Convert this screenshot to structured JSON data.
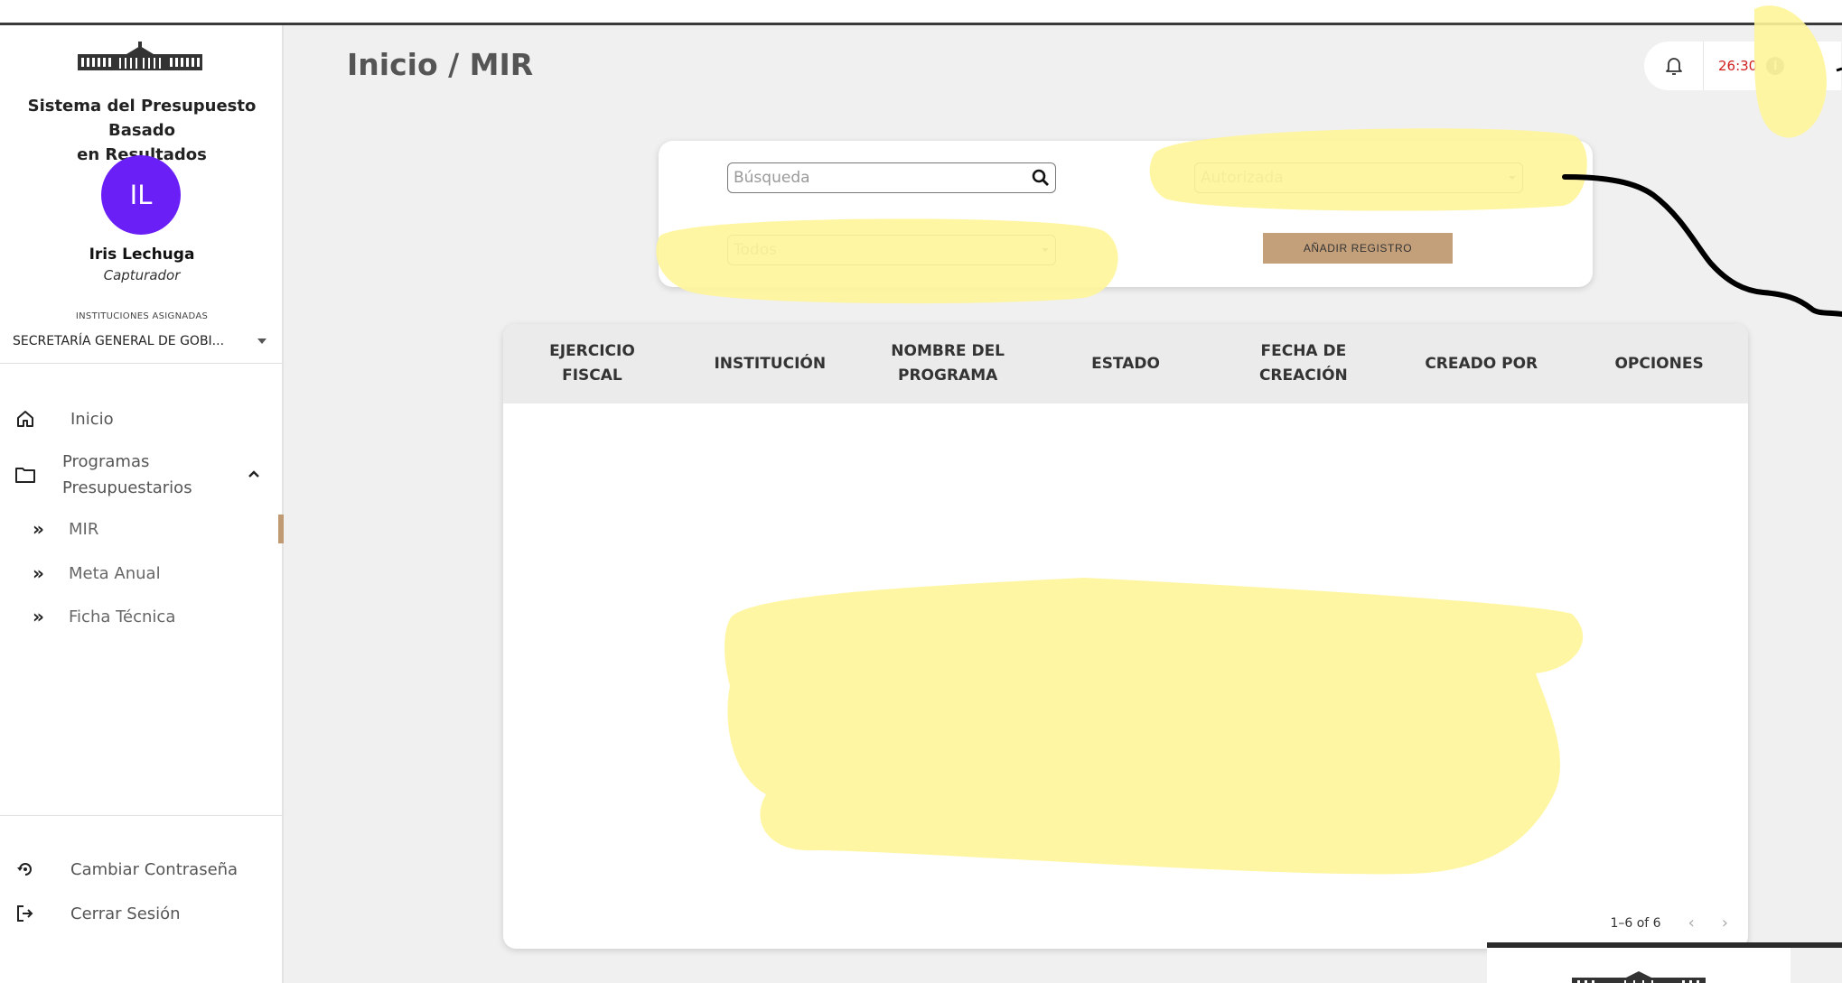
{
  "app": {
    "system_title_line1": "Sistema del Presupuesto Basado",
    "system_title_line2": "en Resultados"
  },
  "user": {
    "initials": "IL",
    "name": "Iris Lechuga",
    "role": "Capturador",
    "avatar_color": "#6a1ff7"
  },
  "institutions": {
    "label": "INSTITUCIONES ASIGNADAS",
    "selected": "SECRETARÍA GENERAL DE GOBI..."
  },
  "nav": {
    "inicio": "Inicio",
    "programas_line1": "Programas",
    "programas_line2": "Presupuestarios",
    "sub": [
      {
        "label": "MIR",
        "active": true
      },
      {
        "label": "Meta Anual",
        "active": false
      },
      {
        "label": "Ficha Técnica",
        "active": false
      }
    ],
    "change_password": "Cambiar Contraseña",
    "logout": "Cerrar Sesión"
  },
  "header": {
    "breadcrumb": "Inicio / MIR",
    "timer": "26:30"
  },
  "filters": {
    "search_placeholder": "Búsqueda",
    "status_value": "Autorizada",
    "scope_value": "Todos",
    "add_button": "AÑADIR REGISTRO"
  },
  "table": {
    "headers": [
      [
        "EJERCICIO",
        "FISCAL"
      ],
      [
        "INSTITUCIÓN",
        ""
      ],
      [
        "NOMBRE DEL",
        "PROGRAMA"
      ],
      [
        "ESTADO",
        ""
      ],
      [
        "FECHA DE",
        "CREACIÓN"
      ],
      [
        "CREADO POR",
        ""
      ],
      [
        "OPCIONES",
        ""
      ]
    ],
    "pagination": "1–6 of 6"
  },
  "colors": {
    "accent": "#c4a07a",
    "highlight": "#fff59a",
    "timer": "#d02020"
  }
}
